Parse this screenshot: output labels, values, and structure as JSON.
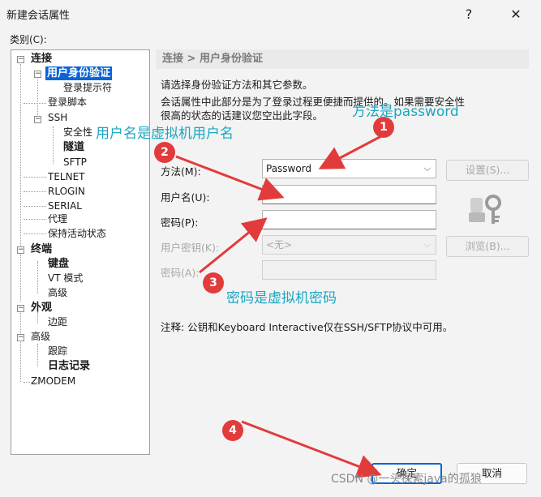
{
  "window": {
    "title": "新建会话属性",
    "help_icon": "?",
    "close_icon": "✕"
  },
  "category_label": "类别(C):",
  "tree": [
    {
      "label": "连接",
      "bold": true
    },
    {
      "label": "用户身份验证",
      "bold": true,
      "selected": true
    },
    {
      "label": "登录提示符"
    },
    {
      "label": "登录脚本"
    },
    {
      "label": "SSH"
    },
    {
      "label": "安全性"
    },
    {
      "label": "隧道",
      "bold": true
    },
    {
      "label": "SFTP"
    },
    {
      "label": "TELNET"
    },
    {
      "label": "RLOGIN"
    },
    {
      "label": "SERIAL"
    },
    {
      "label": "代理"
    },
    {
      "label": "保持活动状态"
    },
    {
      "label": "终端",
      "bold": true
    },
    {
      "label": "键盘",
      "bold": true
    },
    {
      "label": "VT 模式"
    },
    {
      "label": "高级"
    },
    {
      "label": "外观",
      "bold": true
    },
    {
      "label": "边距"
    },
    {
      "label": "高级"
    },
    {
      "label": "跟踪"
    },
    {
      "label": "日志记录",
      "bold": true
    },
    {
      "label": "ZMODEM"
    }
  ],
  "panel": {
    "breadcrumb": "连接 > 用户身份验证",
    "intro": "请选择身份验证方法和其它参数。",
    "desc_line1": "会话属性中此部分是为了登录过程更便捷而提供的。如果需要安全性",
    "desc_line2": "很高的状态的话建议您空出此字段。",
    "method_label": "方法(M):",
    "method_value": "Password",
    "settings_button": "设置(S)...",
    "username_label": "用户名(U):",
    "username_value": "",
    "password_label": "密码(P):",
    "password_value": "",
    "userkey_label": "用户密钥(K):",
    "userkey_value": "<无>",
    "browse_button": "浏览(B)...",
    "passphrase_label": "密码(A):",
    "passphrase_value": "",
    "note": "注释: 公钥和Keyboard Interactive仅在SSH/SFTP协议中可用。"
  },
  "footer": {
    "ok_button": "确定",
    "cancel_button": "取消"
  },
  "annotations": {
    "n1": "1",
    "t1": "方法是password",
    "n2": "2",
    "t2": "用户名是虚拟机用户名",
    "n3": "3",
    "t3": "密码是虚拟机密码",
    "n4": "4"
  },
  "watermark": "CSDN @一头探索java的孤狼",
  "colors": {
    "annotation_text": "#1aa6c2",
    "annotation_arrow": "#e23b3b",
    "selection": "#0a64d6"
  }
}
